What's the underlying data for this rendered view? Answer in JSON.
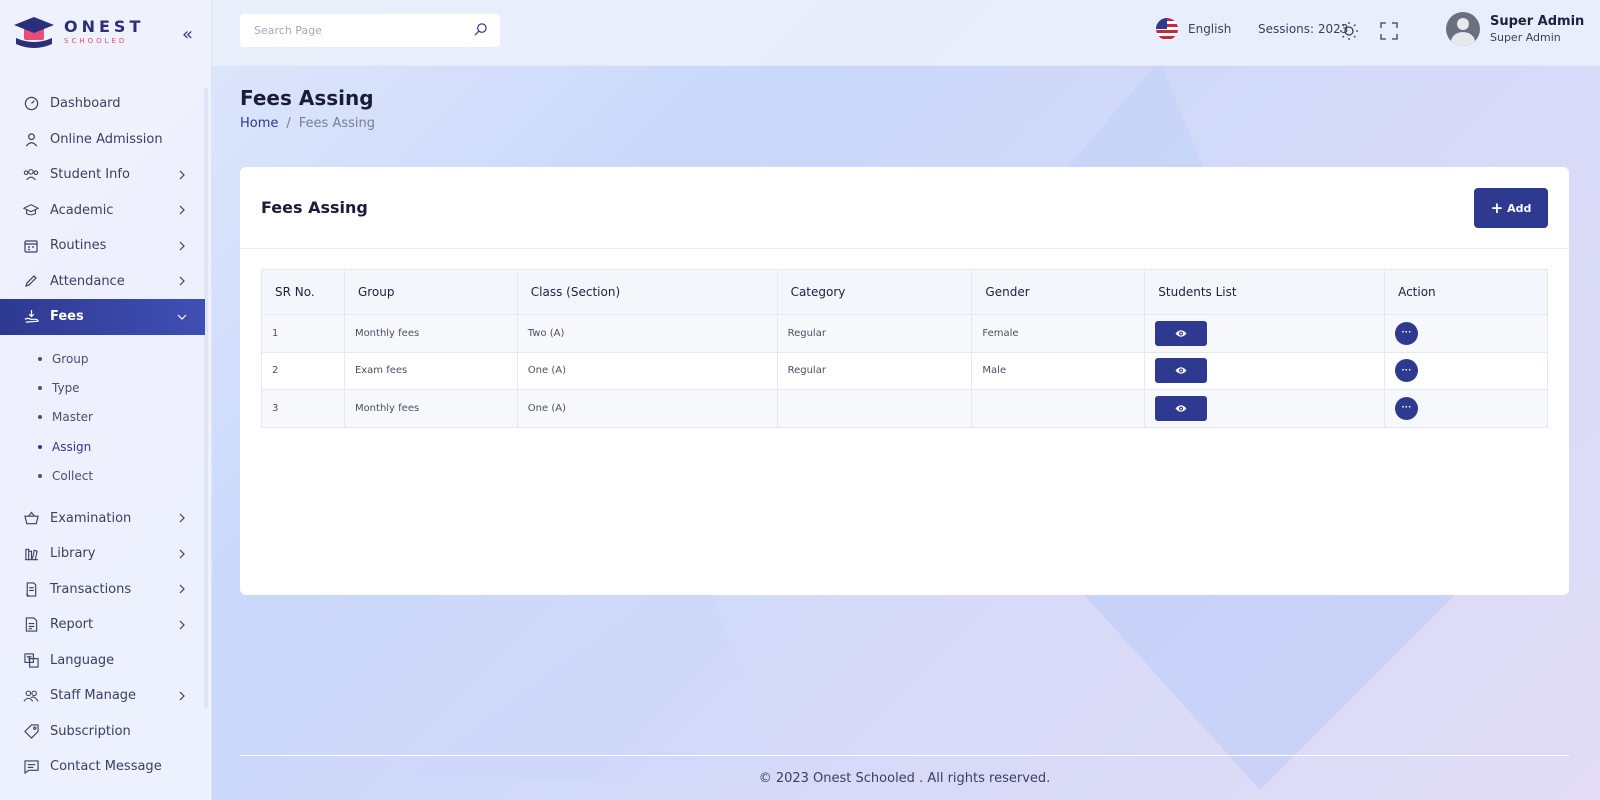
{
  "brand": {
    "name": "ONEST",
    "sub": "SCHOOLED"
  },
  "search": {
    "placeholder": "Search Page"
  },
  "topbar": {
    "language": "English",
    "session": "Sessions: 2023",
    "user_name": "Super Admin",
    "user_role": "Super Admin"
  },
  "sidebar": {
    "items": [
      {
        "label": "Dashboard",
        "icon": "dashboard-icon"
      },
      {
        "label": "Online Admission",
        "icon": "user-icon"
      },
      {
        "label": "Student Info",
        "icon": "students-icon"
      },
      {
        "label": "Academic",
        "icon": "graduation-cap-icon"
      },
      {
        "label": "Routines",
        "icon": "calendar-icon"
      },
      {
        "label": "Attendance",
        "icon": "pen-icon"
      },
      {
        "label": "Fees",
        "icon": "hand-money-icon"
      },
      {
        "label": "Examination",
        "icon": "basket-icon"
      },
      {
        "label": "Library",
        "icon": "books-icon"
      },
      {
        "label": "Transactions",
        "icon": "ledger-icon"
      },
      {
        "label": "Report",
        "icon": "document-icon"
      },
      {
        "label": "Language",
        "icon": "translate-icon"
      },
      {
        "label": "Staff Manage",
        "icon": "users-icon"
      },
      {
        "label": "Subscription",
        "icon": "tag-icon"
      },
      {
        "label": "Contact Message",
        "icon": "message-icon"
      }
    ],
    "fees_sub": [
      "Group",
      "Type",
      "Master",
      "Assign",
      "Collect"
    ]
  },
  "page": {
    "title": "Fees Assing",
    "breadcrumb_home": "Home",
    "breadcrumb_sep": "/",
    "breadcrumb_current": "Fees Assing"
  },
  "card": {
    "title": "Fees Assing",
    "add_label": "Add"
  },
  "table": {
    "headers": [
      "SR No.",
      "Group",
      "Class (Section)",
      "Category",
      "Gender",
      "Students List",
      "Action"
    ],
    "rows": [
      {
        "sr": "1",
        "group": "Monthly fees",
        "class": "Two (A)",
        "category": "Regular",
        "gender": "Female"
      },
      {
        "sr": "2",
        "group": "Exam fees",
        "class": "One (A)",
        "category": "Regular",
        "gender": "Male"
      },
      {
        "sr": "3",
        "group": "Monthly fees",
        "class": "One (A)",
        "category": "",
        "gender": ""
      }
    ]
  },
  "footer": {
    "text": "© 2023 Onest Schooled . All rights reserved."
  },
  "colors": {
    "primary": "#2e3990",
    "accent": "#e84c7a"
  }
}
